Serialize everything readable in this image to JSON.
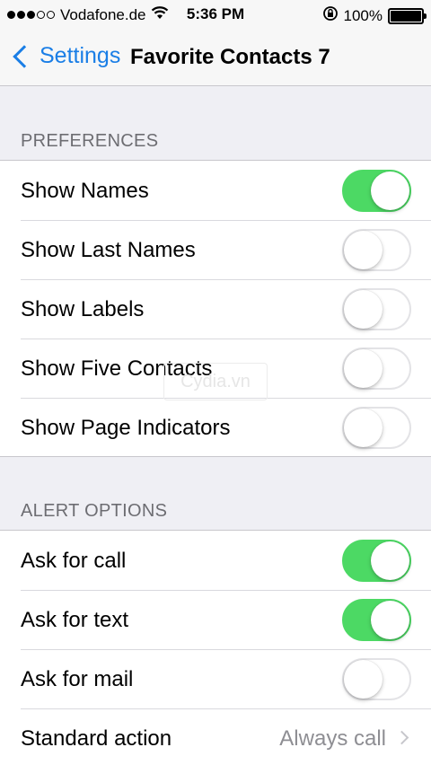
{
  "status_bar": {
    "carrier": "Vodafone.de",
    "time": "5:36 PM",
    "battery": "100%",
    "signal_bars_filled": 3,
    "signal_bars_total": 5
  },
  "nav": {
    "back_label": "Settings",
    "title": "Favorite Contacts 7"
  },
  "sections": {
    "preferences": {
      "header": "PREFERENCES",
      "rows": [
        {
          "label": "Show Names",
          "on": true
        },
        {
          "label": "Show Last Names",
          "on": false
        },
        {
          "label": "Show Labels",
          "on": false
        },
        {
          "label": "Show Five Contacts",
          "on": false
        },
        {
          "label": "Show Page Indicators",
          "on": false
        }
      ]
    },
    "alert_options": {
      "header": "ALERT OPTIONS",
      "rows": [
        {
          "label": "Ask for call",
          "on": true
        },
        {
          "label": "Ask for text",
          "on": true
        },
        {
          "label": "Ask for mail",
          "on": false
        }
      ],
      "standard_action": {
        "label": "Standard action",
        "value": "Always call"
      }
    }
  },
  "watermark": "Cydia.vn",
  "colors": {
    "accent": "#1a7ee6",
    "toggle_on": "#4cd964",
    "background": "#efeff4",
    "section_header": "#6d6d72",
    "detail_text": "#8e8e93"
  },
  "icons": [
    "wifi-icon",
    "rotation-lock-icon",
    "battery-icon",
    "back-chevron-icon",
    "disclosure-chevron-icon"
  ]
}
